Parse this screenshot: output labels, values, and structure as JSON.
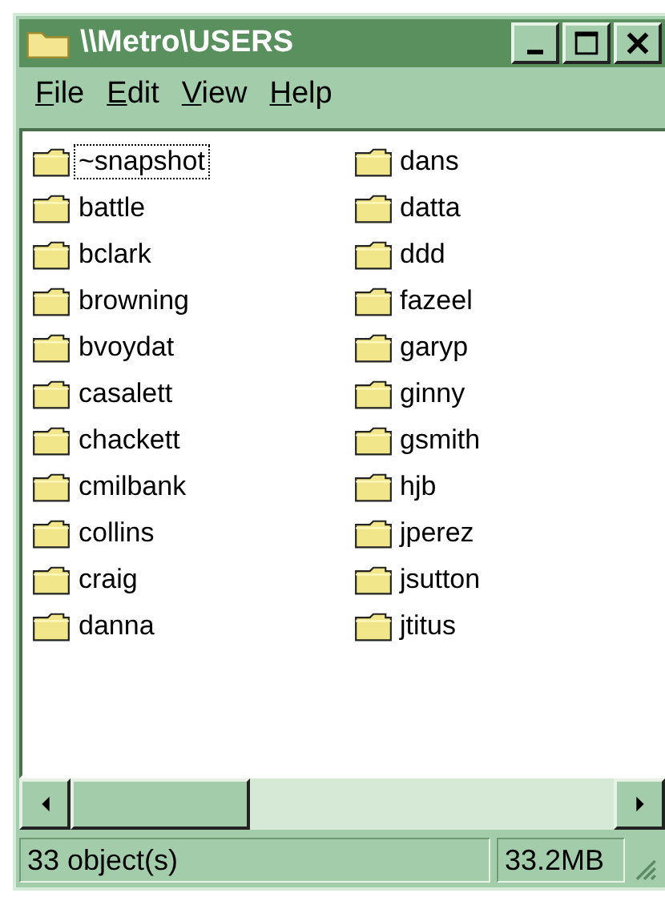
{
  "window": {
    "title": "\\\\Metro\\USERS"
  },
  "menu": [
    "File",
    "Edit",
    "View",
    "Help"
  ],
  "items": [
    {
      "name": "~snapshot",
      "focused": true
    },
    {
      "name": "battle",
      "focused": false
    },
    {
      "name": "bclark",
      "focused": false
    },
    {
      "name": "browning",
      "focused": false
    },
    {
      "name": "bvoydat",
      "focused": false
    },
    {
      "name": "casalett",
      "focused": false
    },
    {
      "name": "chackett",
      "focused": false
    },
    {
      "name": "cmilbank",
      "focused": false
    },
    {
      "name": "collins",
      "focused": false
    },
    {
      "name": "craig",
      "focused": false
    },
    {
      "name": "danna",
      "focused": false
    },
    {
      "name": "dans",
      "focused": false
    },
    {
      "name": "datta",
      "focused": false
    },
    {
      "name": "ddd",
      "focused": false
    },
    {
      "name": "fazeel",
      "focused": false
    },
    {
      "name": "garyp",
      "focused": false
    },
    {
      "name": "ginny",
      "focused": false
    },
    {
      "name": "gsmith",
      "focused": false
    },
    {
      "name": "hjb",
      "focused": false
    },
    {
      "name": "jperez",
      "focused": false
    },
    {
      "name": "jsutton",
      "focused": false
    },
    {
      "name": "jtitus",
      "focused": false
    }
  ],
  "status_bar": {
    "count": "33 object(s)",
    "size": "33.2MB"
  }
}
